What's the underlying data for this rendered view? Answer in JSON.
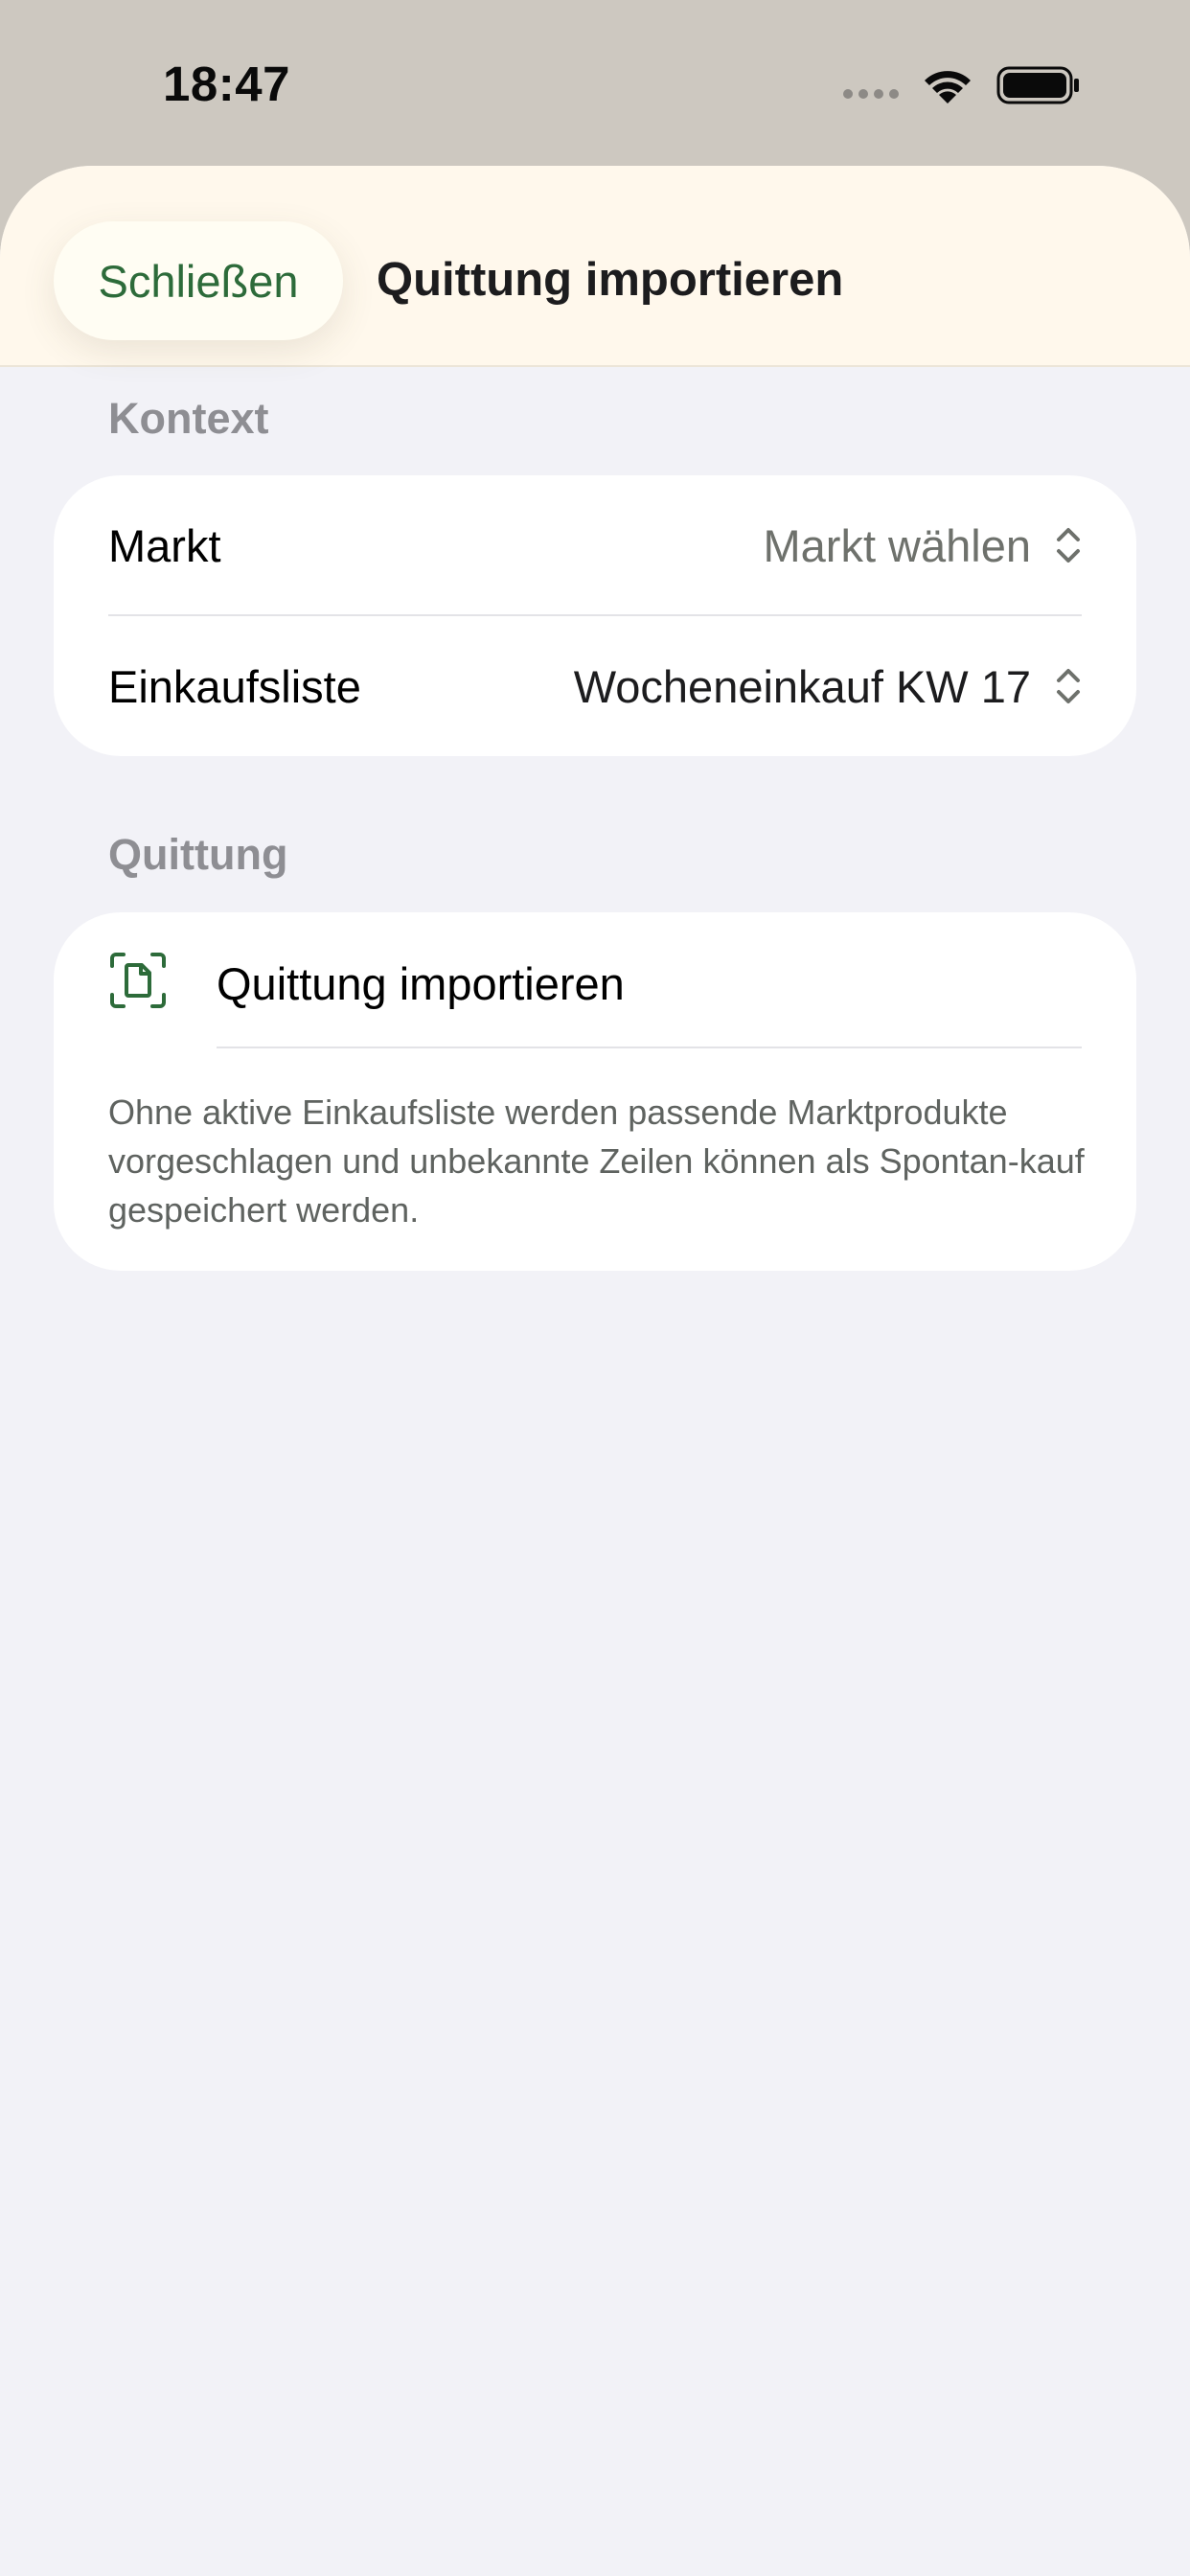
{
  "status_bar": {
    "time": "18:47",
    "icons": [
      "cellular-signal-icon",
      "wifi-icon",
      "battery-icon"
    ]
  },
  "nav": {
    "close_label": "Schließen",
    "title": "Quittung importieren"
  },
  "context_section": {
    "header": "Kontext",
    "rows": [
      {
        "label": "Markt",
        "value": "Markt wählen"
      },
      {
        "label": "Einkaufsliste",
        "value": "Wocheneinkauf KW 17"
      }
    ]
  },
  "receipt_section": {
    "header": "Quittung",
    "action_label": "Quittung importieren",
    "action_icon": "document-scan-icon",
    "footnote": "Ohne aktive Einkaufsliste werden passende Marktprodukte vorgeschlagen und unbekannte Zeilen können als Spontan-kauf gespeichert werden."
  },
  "colors": {
    "accent_green": "#2d6b3a",
    "nav_background": "#fff8ec",
    "sheet_background": "#f2f2f7",
    "status_background": "#cdc8c0"
  }
}
